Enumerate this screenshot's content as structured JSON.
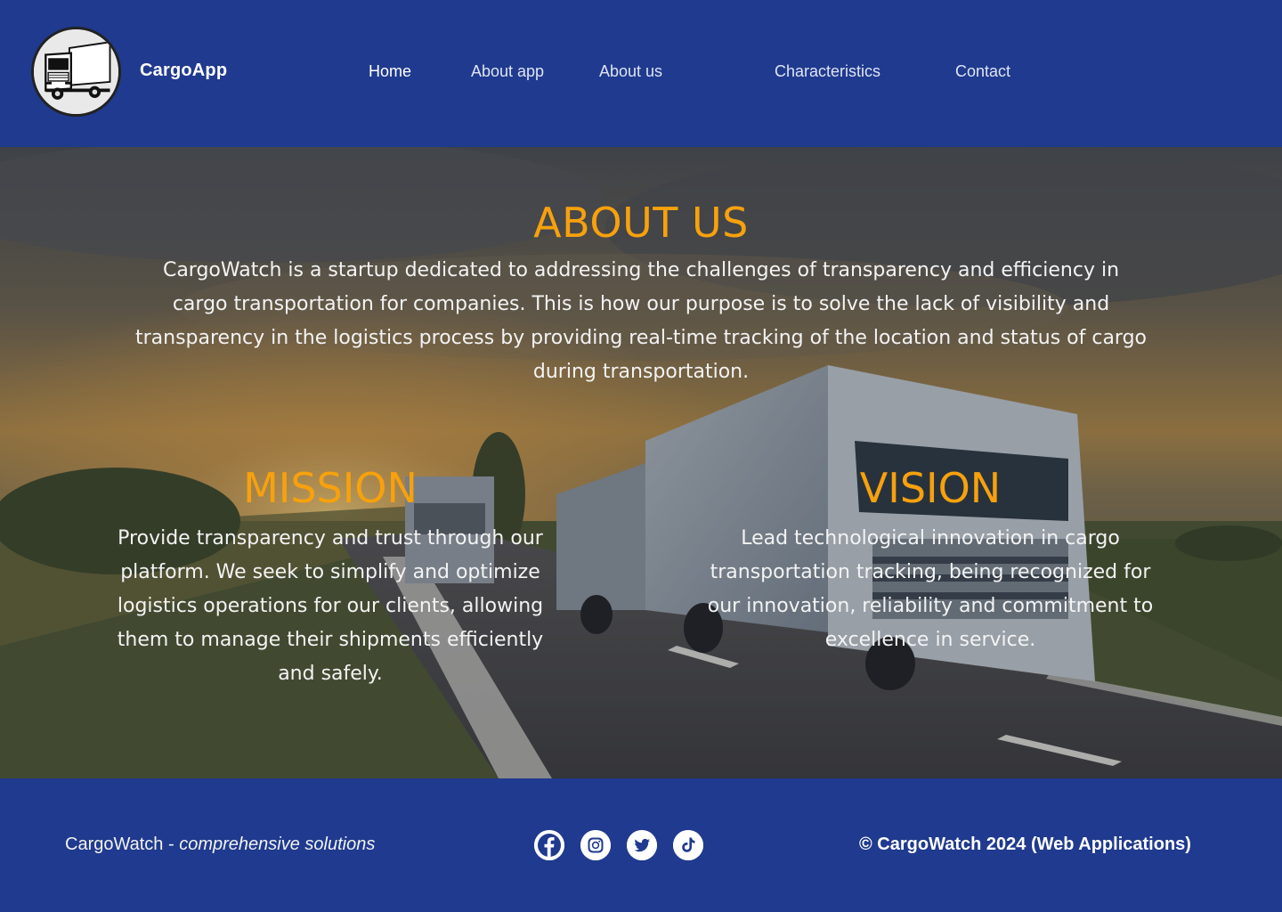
{
  "header": {
    "brand": "CargoApp",
    "logo": "truck-logo",
    "nav": [
      {
        "label": "Home",
        "active": true
      },
      {
        "label": "About app",
        "active": false
      },
      {
        "label": "About us",
        "active": false
      },
      {
        "label": "Characteristics",
        "active": false
      },
      {
        "label": "Contact",
        "active": false
      }
    ]
  },
  "about": {
    "title": "ABOUT US",
    "text": "CargoWatch is a startup dedicated to addressing the challenges of transparency and efficiency in cargo transportation for companies. This is how our purpose is to solve the lack of visibility and transparency in the logistics process by providing real-time tracking of the location and status of cargo during transportation."
  },
  "mission": {
    "title": "MISSION",
    "text": "Provide transparency and trust through our platform. We seek to simplify and optimize logistics operations for our clients, allowing them to manage their shipments efficiently and safely."
  },
  "vision": {
    "title": "VISION",
    "text": "Lead technological innovation in cargo transportation tracking, being recognized for our innovation, reliability and commitment to excellence in service."
  },
  "footer": {
    "brand": "CargoWatch",
    "separator": " - ",
    "tagline": "comprehensive solutions",
    "socials": [
      "facebook-icon",
      "instagram-icon",
      "twitter-icon",
      "tiktok-icon"
    ],
    "copyright": "© CargoWatch 2024 (Web Applications)"
  },
  "colors": {
    "header_bg": "#1f3a8e",
    "accent": "#f7a10d",
    "text": "#ffffff"
  }
}
